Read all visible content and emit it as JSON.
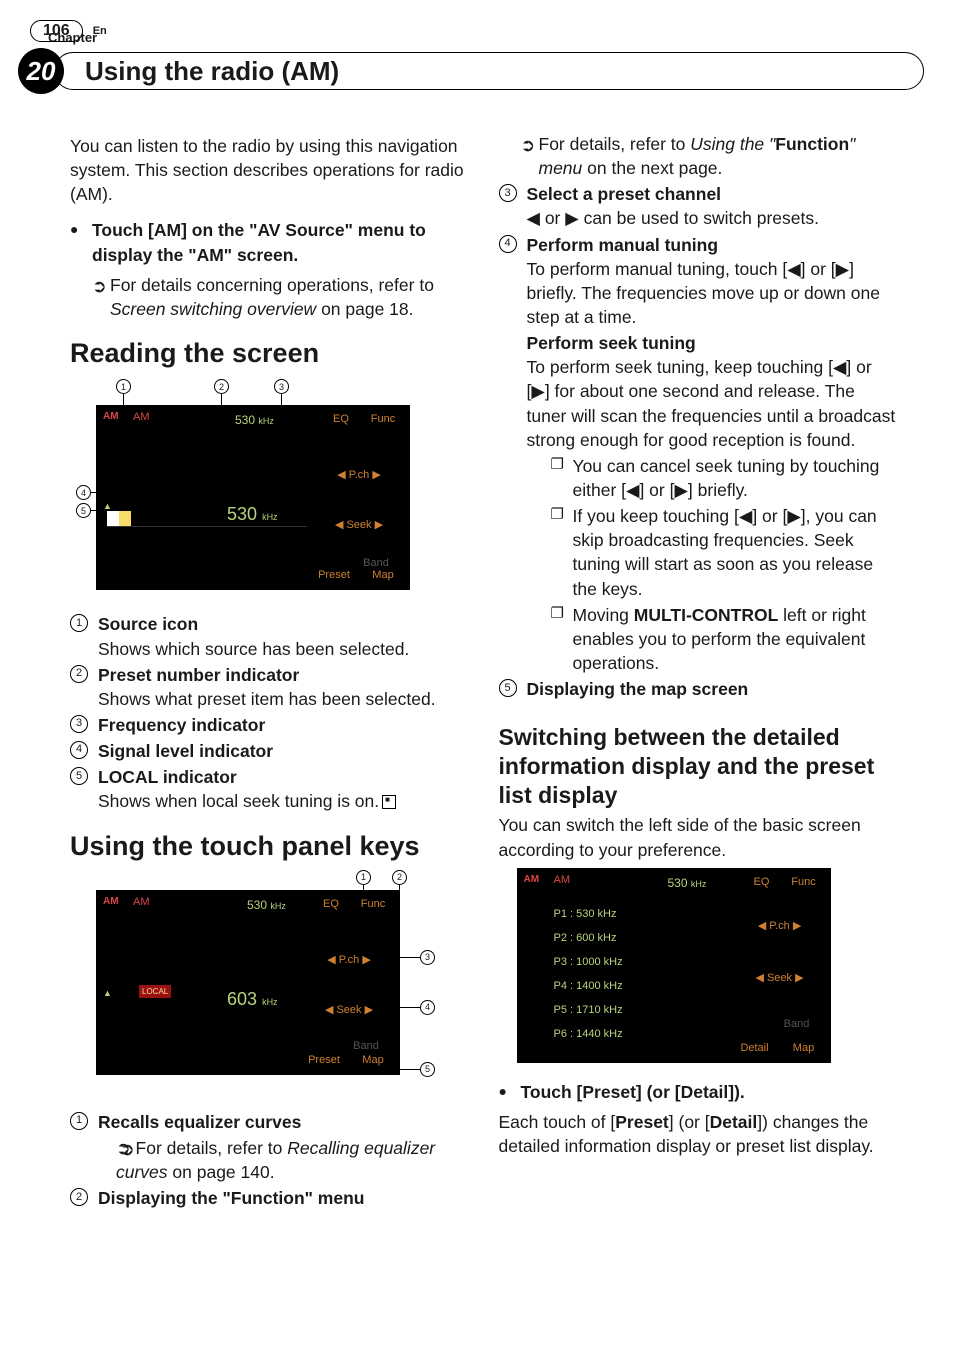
{
  "header": {
    "chapter_label": "Chapter",
    "chapter_number": "20",
    "title": "Using the radio (AM)"
  },
  "col1": {
    "intro": "You can listen to the radio by using this navigation system. This section describes operations for radio (AM).",
    "step1": "Touch [AM] on the \"AV Source\" menu to display the \"AM\" screen.",
    "xref1_a": "For details concerning operations, refer to ",
    "xref1_i": "Screen switching overview",
    "xref1_b": " on page 18.",
    "h2_reading": "Reading the screen",
    "items": [
      {
        "num": "1",
        "title": "Source icon",
        "desc": "Shows which source has been selected."
      },
      {
        "num": "2",
        "title": "Preset number indicator",
        "desc": "Shows what preset item has been selected."
      },
      {
        "num": "3",
        "title": "Frequency indicator",
        "desc": ""
      },
      {
        "num": "4",
        "title": "Signal level indicator",
        "desc": ""
      },
      {
        "num": "5",
        "title": "LOCAL indicator",
        "desc": "Shows when local seek tuning is on."
      }
    ],
    "h2_touch": "Using the touch panel keys",
    "touch_items": [
      {
        "num": "1",
        "title": "Recalls equalizer curves",
        "xref_a": "For details, refer to ",
        "xref_i": "Recalling equalizer curves",
        "xref_b": " on page 140."
      },
      {
        "num": "2",
        "title": "Displaying the \"Function\" menu"
      }
    ]
  },
  "col2": {
    "xref_top_a": "For details, refer to ",
    "xref_top_i1": "Using the",
    "xref_top_q1": "\"",
    "xref_top_b": "Function",
    "xref_top_q2": "\"",
    "xref_top_i2": " menu",
    "xref_top_tail": " on the next page.",
    "it3_title": "Select a preset channel",
    "it3_desc": "◀ or ▶ can be used to switch presets.",
    "it4_title": "Perform manual tuning",
    "it4_desc": "To perform manual tuning, touch [◀] or [▶] briefly. The frequencies move up or down one step at a time.",
    "seek_title": "Perform seek tuning",
    "seek_desc": "To perform seek tuning, keep touching [◀] or [▶] for about one second and release. The tuner will scan the frequencies until a broadcast strong enough for good reception is found.",
    "seek_p1": "You can cancel seek tuning by touching either [◀] or [▶] briefly.",
    "seek_p2": "If you keep touching [◀] or [▶], you can skip broadcasting frequencies. Seek tuning will start as soon as you release the keys.",
    "seek_p3_a": "Moving ",
    "seek_p3_b": "MULTI-CONTROL",
    "seek_p3_c": " left or right enables you to perform the equivalent operations.",
    "it5_title": "Displaying the map screen",
    "h3": "Switching between the detailed information display and the preset list display",
    "h3_desc": "You can switch the left side of the basic screen according to your preference.",
    "step2": "Touch [Preset] (or [Detail]).",
    "step2_desc_a": "Each touch of [",
    "step2_desc_b1": "Preset",
    "step2_desc_c": "] (or [",
    "step2_desc_b2": "Detail",
    "step2_desc_d": "]) changes the detailed information display or preset list display."
  },
  "shots": {
    "common": {
      "am": "AM",
      "src": "AM",
      "eq": "EQ",
      "func": "Func",
      "pch": "◀  P.ch  ▶",
      "seek": "◀  Seek  ▶",
      "band": "Band",
      "preset": "Preset",
      "detail": "Detail",
      "map": "Map",
      "khz": "kHz"
    },
    "s1": {
      "freq_top": "530",
      "bigfreq": "530",
      "sig": "▲"
    },
    "s2": {
      "freq_top": "530",
      "bigfreq": "603",
      "local": "LOCAL",
      "map_label": "Map"
    },
    "s3": {
      "freq_top": "530",
      "presets": [
        "P1  : 530 kHz",
        "P2  : 600 kHz",
        "P3  : 1000 kHz",
        "P4  : 1400 kHz",
        "P5  : 1710 kHz",
        "P6  : 1440 kHz"
      ]
    },
    "nums": {
      "n1": "1",
      "n2": "2",
      "n3": "3",
      "n4": "4",
      "n5": "5"
    }
  },
  "footer": {
    "page": "106",
    "lang": "En"
  }
}
